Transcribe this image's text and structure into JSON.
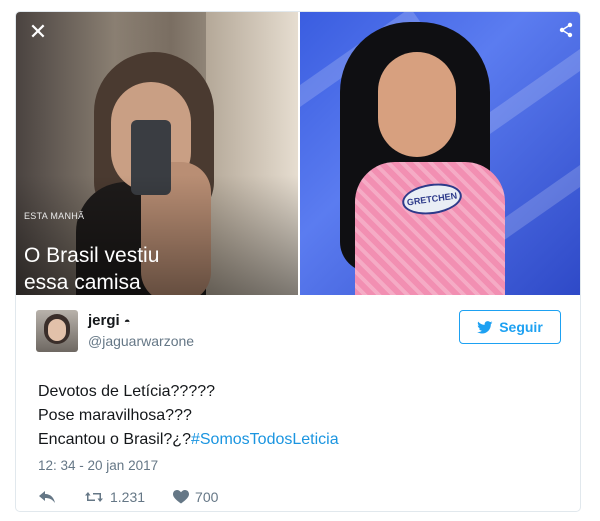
{
  "media": {
    "left": {
      "kicker": "ESTA MANHÃ",
      "headline_line1": "O Brasil vestiu",
      "headline_line2": "essa camisa"
    },
    "right": {
      "badge": "GRETCHEN"
    }
  },
  "tweet": {
    "name": "jergi",
    "handle": "@jaguarwarzone",
    "follow_label": "Seguir",
    "line1": "Devotos de Letícia?????",
    "line2": "Pose maravilhosa???",
    "line3_prefix": "Encantou o Brasil?¿?",
    "hashtag": "#SomosTodosLeticia",
    "timestamp": "12: 34 - 20 jan 2017",
    "retweets": "1.231",
    "likes": "700"
  },
  "colors": {
    "accent": "#1da1f2",
    "link": "#1b95e0",
    "muted": "#657786",
    "border": "#e1e8ed"
  },
  "icons": {
    "close": "close-icon",
    "share": "share-icon",
    "reply": "reply-icon",
    "retweet": "retweet-icon",
    "like": "heart-icon",
    "bird": "twitter-bird-icon"
  }
}
